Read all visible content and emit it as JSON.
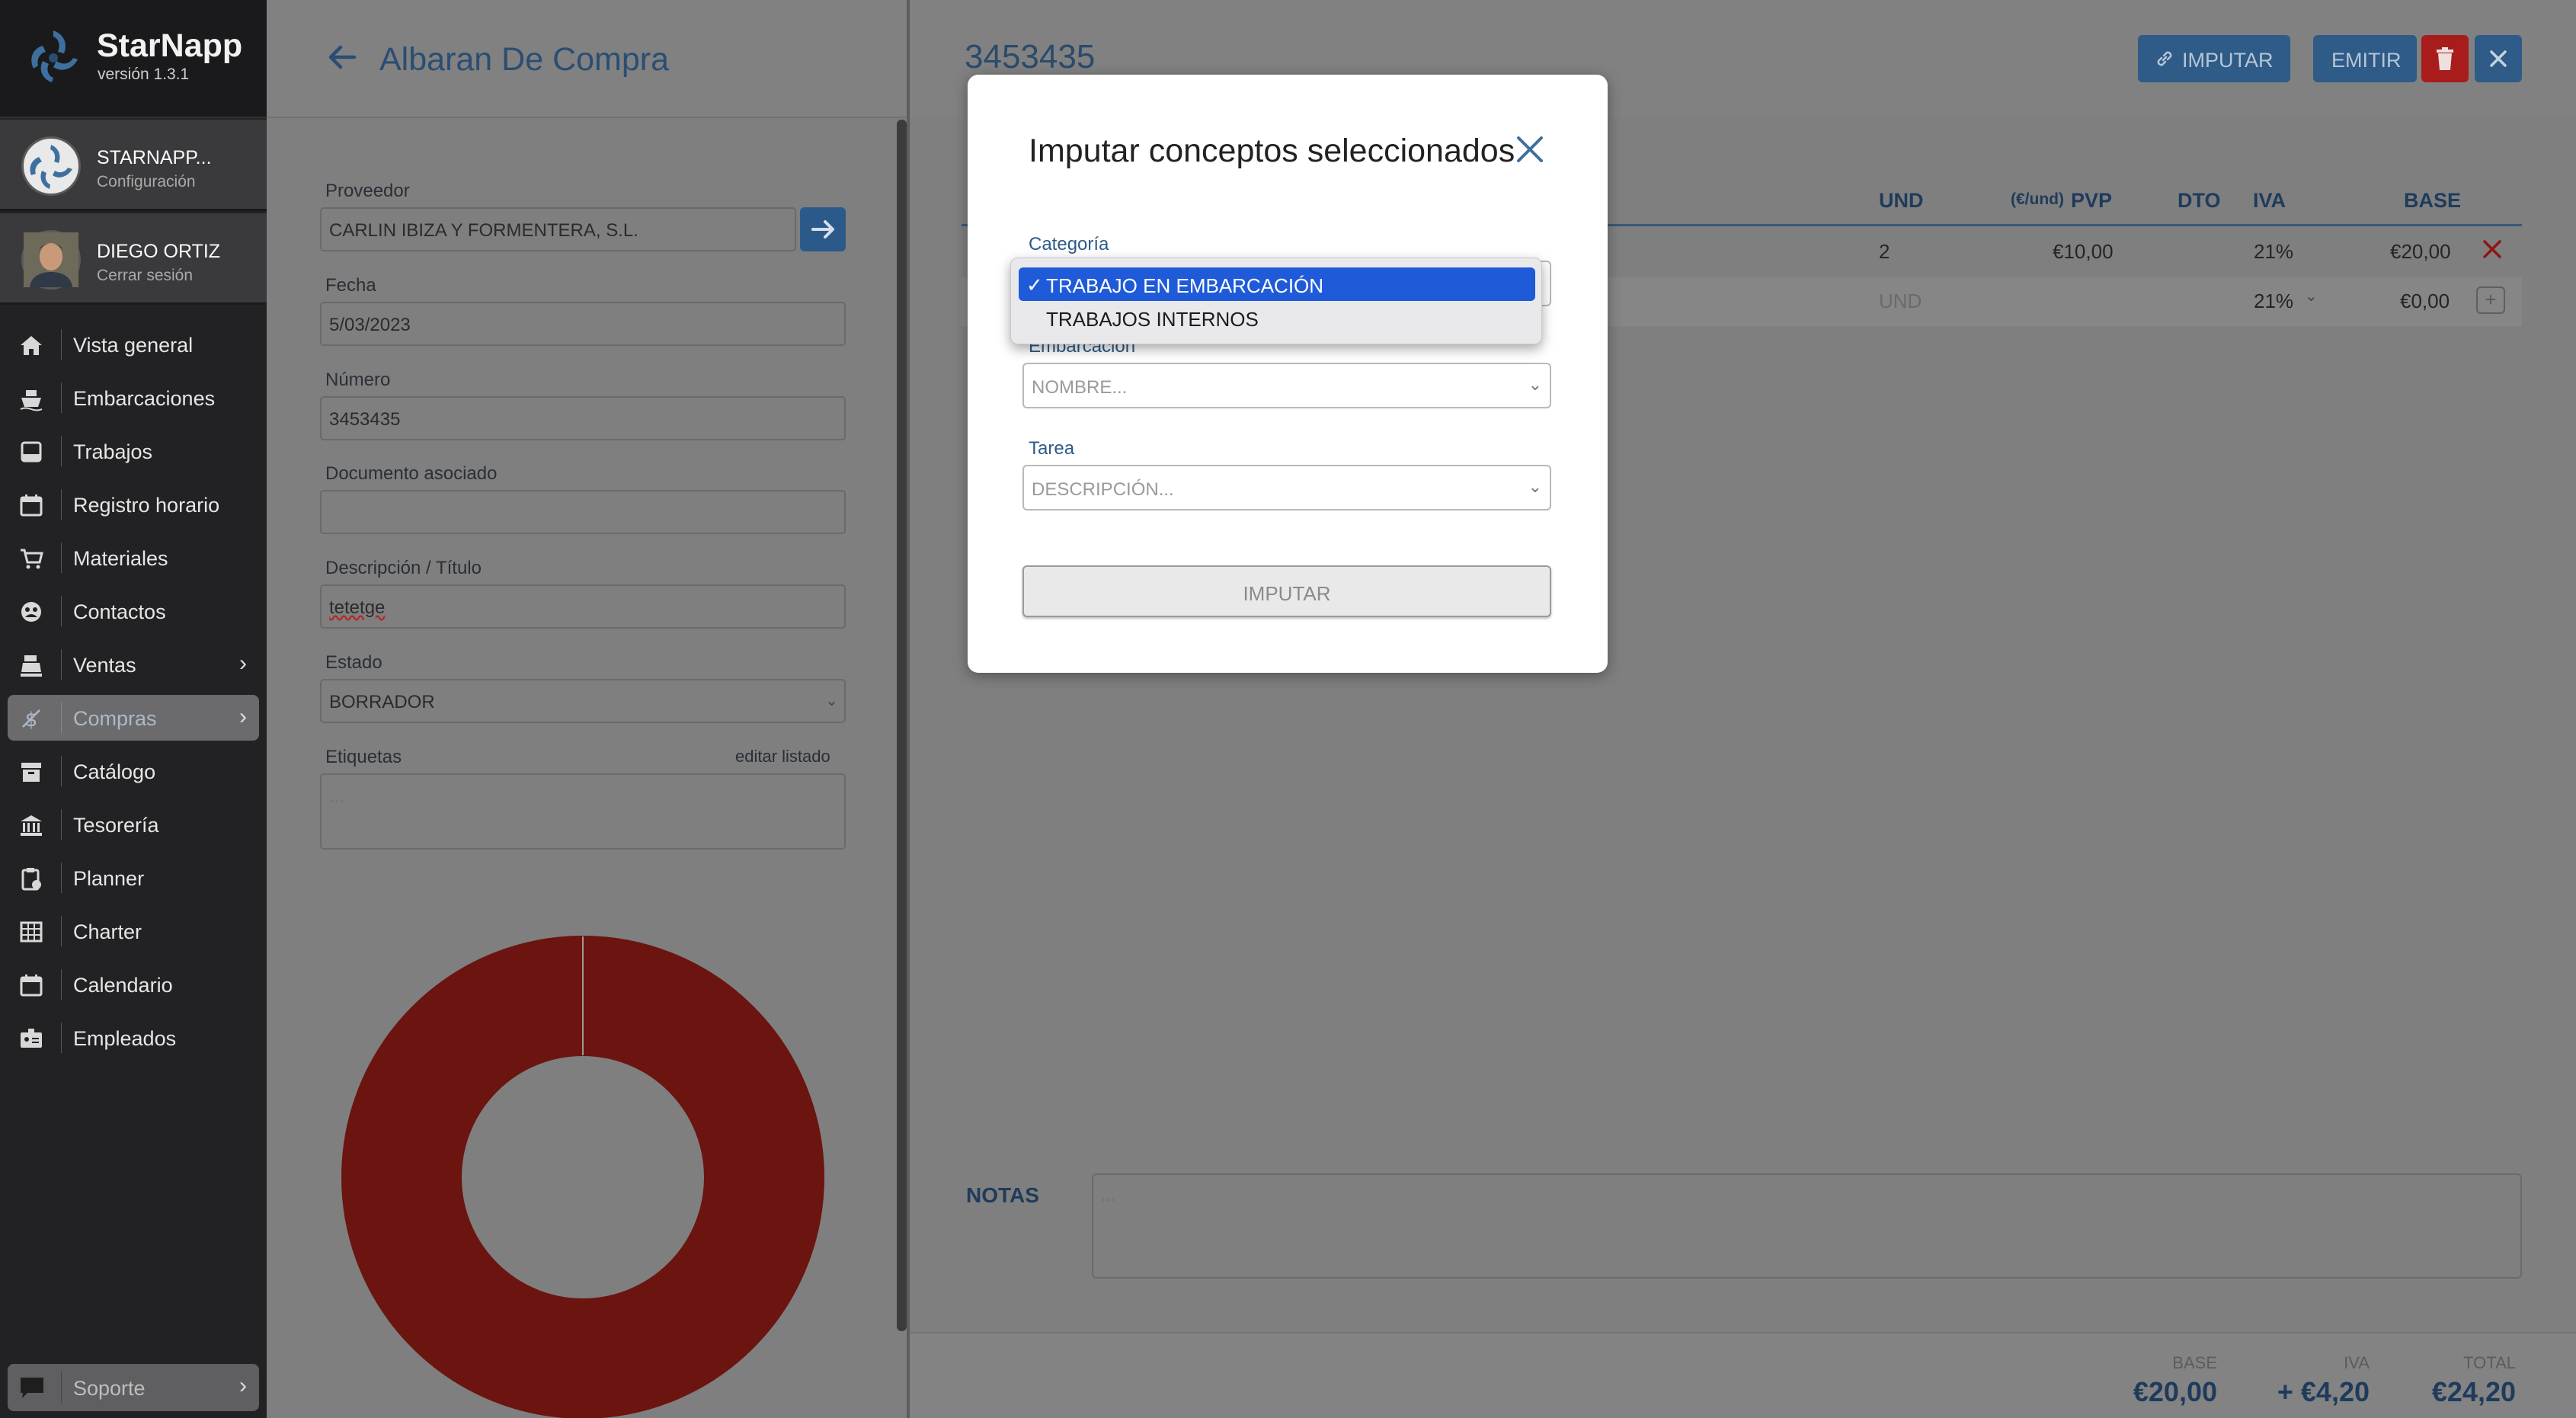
{
  "app": {
    "name": "StarNapp",
    "version": "versión 1.3.1"
  },
  "account": {
    "company": "STARNAPP...",
    "company_sub": "Configuración",
    "user": "DIEGO ORTIZ",
    "user_sub": "Cerrar sesión"
  },
  "nav": {
    "items": [
      {
        "label": "Vista general",
        "icon": "home-icon"
      },
      {
        "label": "Embarcaciones",
        "icon": "ship-icon"
      },
      {
        "label": "Trabajos",
        "icon": "inbox-icon"
      },
      {
        "label": "Registro horario",
        "icon": "calendar-icon"
      },
      {
        "label": "Materiales",
        "icon": "cart-icon"
      },
      {
        "label": "Contactos",
        "icon": "contacts-icon"
      },
      {
        "label": "Ventas",
        "icon": "register-icon"
      },
      {
        "label": "Compras",
        "icon": "dollar-icon"
      },
      {
        "label": "Catálogo",
        "icon": "archive-icon"
      },
      {
        "label": "Tesorería",
        "icon": "bank-icon"
      },
      {
        "label": "Planner",
        "icon": "clipboard-icon"
      },
      {
        "label": "Charter",
        "icon": "grid-icon"
      },
      {
        "label": "Calendario",
        "icon": "calendar-icon"
      },
      {
        "label": "Empleados",
        "icon": "badge-icon"
      }
    ],
    "support": "Soporte"
  },
  "page": {
    "title": "Albaran De Compra",
    "doc_number": "3453435"
  },
  "form": {
    "proveedor_label": "Proveedor",
    "proveedor_value": "CARLIN IBIZA Y FORMENTERA, S.L.",
    "fecha_label": "Fecha",
    "fecha_value": "5/03/2023",
    "numero_label": "Número",
    "numero_value": "3453435",
    "doc_asociado_label": "Documento asociado",
    "doc_asociado_value": "",
    "descripcion_label": "Descripción / Título",
    "descripcion_value": "tetetge",
    "estado_label": "Estado",
    "estado_value": "BORRADOR",
    "etiquetas_label": "Etiquetas",
    "etiquetas_edit": "editar listado",
    "etiquetas_placeholder": "..."
  },
  "toolbar": {
    "imputar": "IMPUTAR",
    "emitir": "EMITIR"
  },
  "table": {
    "headers": {
      "und": "UND",
      "pvp_unit": "(€/und)",
      "pvp": "PVP",
      "dto": "DTO",
      "iva": "IVA",
      "base": "BASE"
    },
    "row1": {
      "und": "2",
      "pvp": "€10,00",
      "dto": "",
      "iva": "21%",
      "base": "€20,00"
    },
    "row2": {
      "und_placeholder": "UND",
      "iva": "21%",
      "base": "€0,00"
    }
  },
  "notes": {
    "label": "NOTAS",
    "placeholder": "..."
  },
  "totals": {
    "base_label": "BASE",
    "base_value": "€20,00",
    "iva_label": "IVA",
    "iva_value": "+ €4,20",
    "total_label": "TOTAL",
    "total_value": "€24,20"
  },
  "modal": {
    "title": "Imputar conceptos seleccionados",
    "categoria_label": "Categoría",
    "categoria_options": [
      "TRABAJO EN EMBARCACIÓN",
      "TRABAJOS INTERNOS"
    ],
    "categoria_selected": "TRABAJO EN EMBARCACIÓN",
    "embarcacion_label": "Embarcación",
    "embarcacion_placeholder": "NOMBRE...",
    "tarea_label": "Tarea",
    "tarea_placeholder": "DESCRIPCIÓN...",
    "submit": "IMPUTAR"
  },
  "colors": {
    "accent": "#2e5b87",
    "danger": "#b01c1c",
    "donut": "#6b1410",
    "dropdown_selected": "#1f5bd9"
  }
}
